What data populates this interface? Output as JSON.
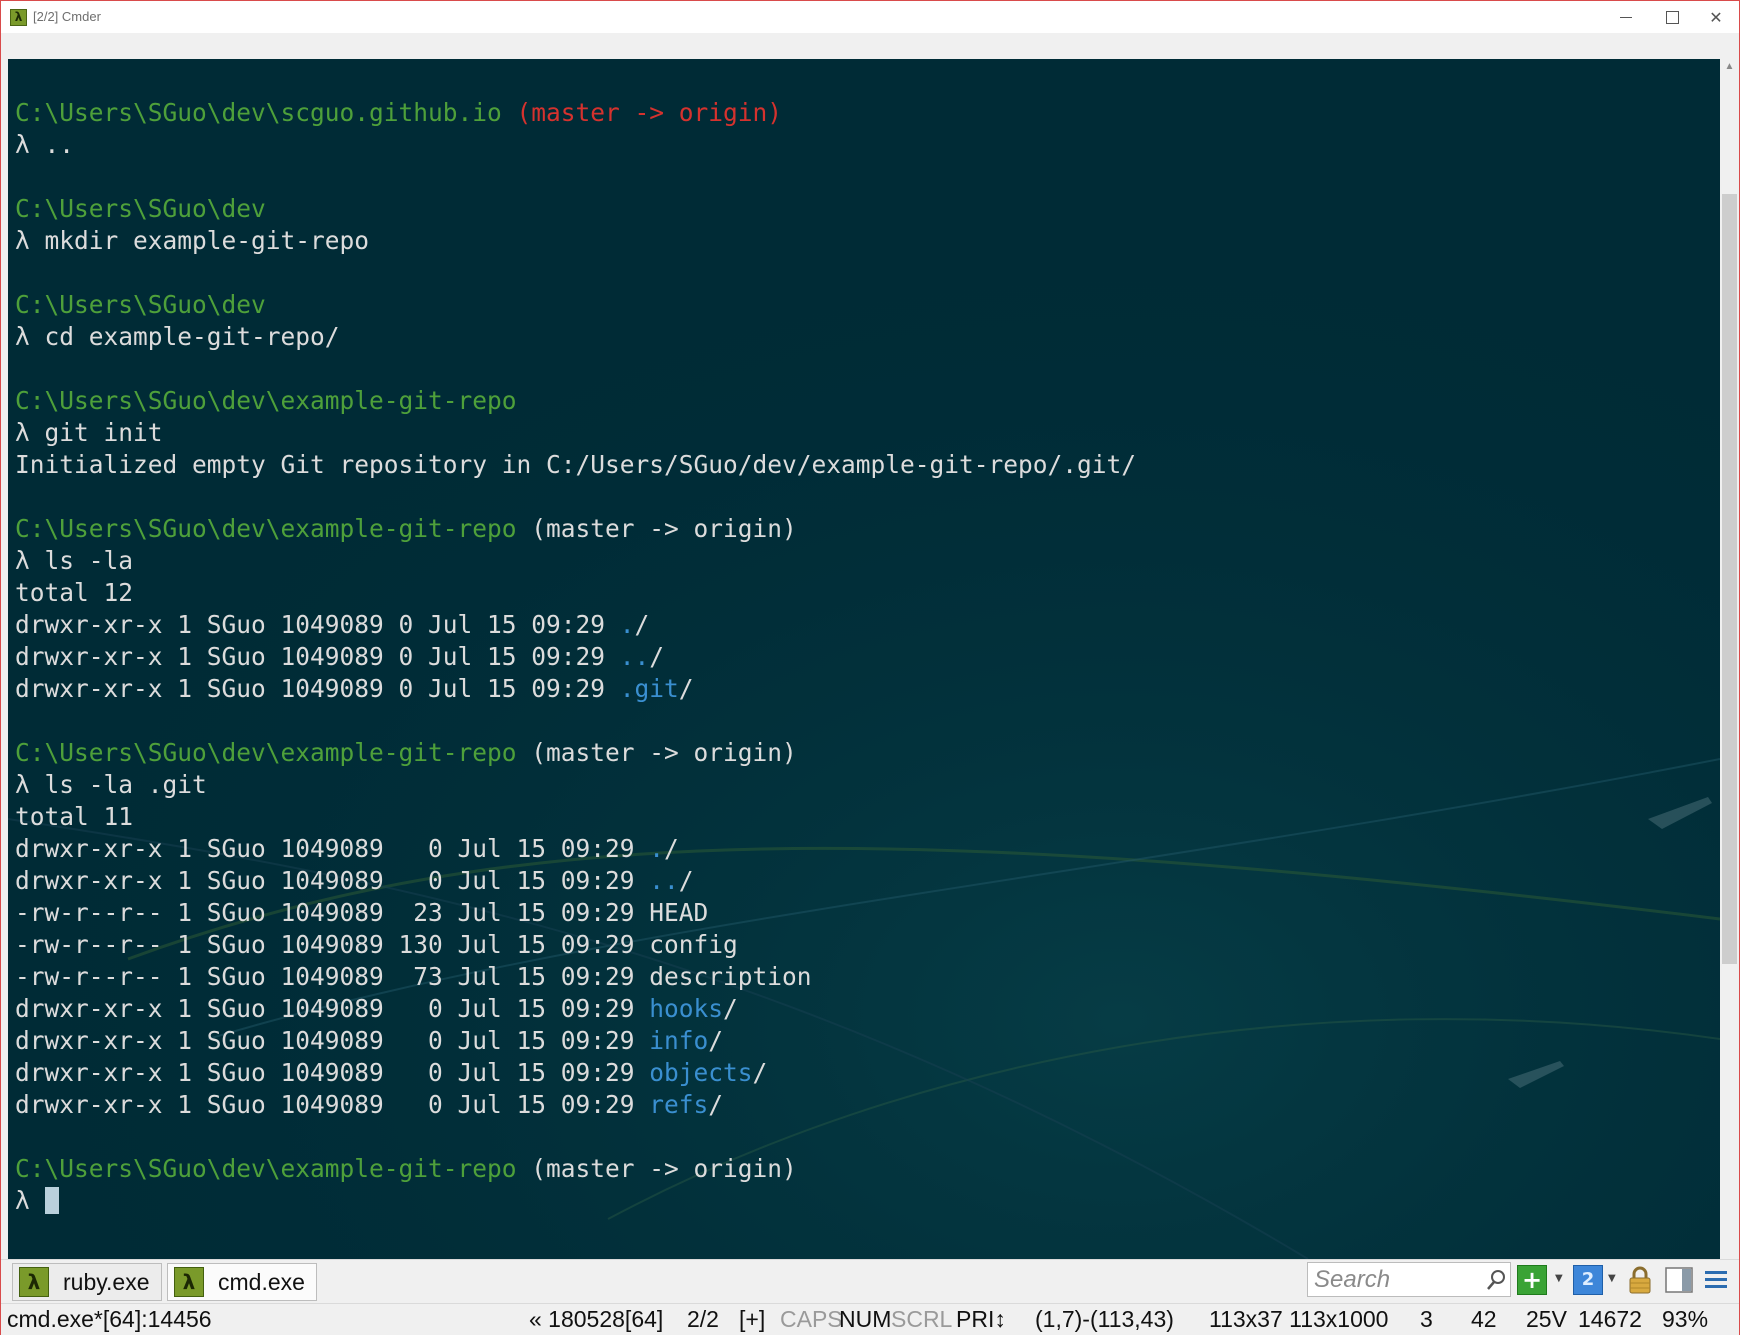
{
  "window": {
    "title": "[2/2] Cmder",
    "icon": "lambda-icon",
    "controls": [
      "minimize-icon",
      "maximize-icon",
      "close-icon"
    ]
  },
  "colors": {
    "console_bg": "#002b36",
    "path": "#4ea03a",
    "branch_red": "#d5322e",
    "directory": "#3a8fd0",
    "text": "#dcdcdc"
  },
  "console": {
    "lines": [
      [
        {
          "t": "C:\\Users\\SGuo\\dev\\scguo.github.io",
          "c": "path"
        },
        {
          "t": " (master -> origin)",
          "c": "red"
        }
      ],
      [
        {
          "t": "λ ..",
          "c": ""
        }
      ],
      [],
      [
        {
          "t": "C:\\Users\\SGuo\\dev",
          "c": "path"
        }
      ],
      [
        {
          "t": "λ mkdir example-git-repo",
          "c": ""
        }
      ],
      [],
      [
        {
          "t": "C:\\Users\\SGuo\\dev",
          "c": "path"
        }
      ],
      [
        {
          "t": "λ cd example-git-repo/",
          "c": ""
        }
      ],
      [],
      [
        {
          "t": "C:\\Users\\SGuo\\dev\\example-git-repo",
          "c": "path"
        }
      ],
      [
        {
          "t": "λ git init",
          "c": ""
        }
      ],
      [
        {
          "t": "Initialized empty Git repository in C:/Users/SGuo/dev/example-git-repo/.git/",
          "c": ""
        }
      ],
      [],
      [
        {
          "t": "C:\\Users\\SGuo\\dev\\example-git-repo",
          "c": "path"
        },
        {
          "t": " (master -> origin)",
          "c": ""
        }
      ],
      [
        {
          "t": "λ ls -la",
          "c": ""
        }
      ],
      [
        {
          "t": "total 12",
          "c": ""
        }
      ],
      [
        {
          "t": "drwxr-xr-x 1 SGuo 1049089 0 Jul 15 09:29 ",
          "c": ""
        },
        {
          "t": ".",
          "c": "dir"
        },
        {
          "t": "/",
          "c": ""
        }
      ],
      [
        {
          "t": "drwxr-xr-x 1 SGuo 1049089 0 Jul 15 09:29 ",
          "c": ""
        },
        {
          "t": "..",
          "c": "dir"
        },
        {
          "t": "/",
          "c": ""
        }
      ],
      [
        {
          "t": "drwxr-xr-x 1 SGuo 1049089 0 Jul 15 09:29 ",
          "c": ""
        },
        {
          "t": ".git",
          "c": "dir"
        },
        {
          "t": "/",
          "c": ""
        }
      ],
      [],
      [
        {
          "t": "C:\\Users\\SGuo\\dev\\example-git-repo",
          "c": "path"
        },
        {
          "t": " (master -> origin)",
          "c": ""
        }
      ],
      [
        {
          "t": "λ ls -la .git",
          "c": ""
        }
      ],
      [
        {
          "t": "total 11",
          "c": ""
        }
      ],
      [
        {
          "t": "drwxr-xr-x 1 SGuo 1049089   0 Jul 15 09:29 ",
          "c": ""
        },
        {
          "t": ".",
          "c": "dir"
        },
        {
          "t": "/",
          "c": ""
        }
      ],
      [
        {
          "t": "drwxr-xr-x 1 SGuo 1049089   0 Jul 15 09:29 ",
          "c": ""
        },
        {
          "t": "..",
          "c": "dir"
        },
        {
          "t": "/",
          "c": ""
        }
      ],
      [
        {
          "t": "-rw-r--r-- 1 SGuo 1049089  23 Jul 15 09:29 HEAD",
          "c": ""
        }
      ],
      [
        {
          "t": "-rw-r--r-- 1 SGuo 1049089 130 Jul 15 09:29 config",
          "c": ""
        }
      ],
      [
        {
          "t": "-rw-r--r-- 1 SGuo 1049089  73 Jul 15 09:29 description",
          "c": ""
        }
      ],
      [
        {
          "t": "drwxr-xr-x 1 SGuo 1049089   0 Jul 15 09:29 ",
          "c": ""
        },
        {
          "t": "hooks",
          "c": "dir"
        },
        {
          "t": "/",
          "c": ""
        }
      ],
      [
        {
          "t": "drwxr-xr-x 1 SGuo 1049089   0 Jul 15 09:29 ",
          "c": ""
        },
        {
          "t": "info",
          "c": "dir"
        },
        {
          "t": "/",
          "c": ""
        }
      ],
      [
        {
          "t": "drwxr-xr-x 1 SGuo 1049089   0 Jul 15 09:29 ",
          "c": ""
        },
        {
          "t": "objects",
          "c": "dir"
        },
        {
          "t": "/",
          "c": ""
        }
      ],
      [
        {
          "t": "drwxr-xr-x 1 SGuo 1049089   0 Jul 15 09:29 ",
          "c": ""
        },
        {
          "t": "refs",
          "c": "dir"
        },
        {
          "t": "/",
          "c": ""
        }
      ],
      [],
      [
        {
          "t": "C:\\Users\\SGuo\\dev\\example-git-repo",
          "c": "path"
        },
        {
          "t": " (master -> origin)",
          "c": ""
        }
      ],
      [
        {
          "t": "λ ",
          "c": ""
        },
        {
          "t": "",
          "c": "cursor"
        }
      ]
    ]
  },
  "tabs": [
    {
      "label": "ruby.exe",
      "icon": "lambda-icon",
      "active": false
    },
    {
      "label": "cmd.exe",
      "icon": "lambda-icon",
      "active": true
    }
  ],
  "toolbar": {
    "search_placeholder": "Search",
    "search_icon": "search-icon",
    "new_console_icon": "plus-icon",
    "console_number": "2",
    "lock_icon": "lock-icon",
    "panel_icon": "split-panel-icon",
    "menu_icon": "hamburger-menu-icon"
  },
  "statusbar": {
    "process": "cmd.exe*[64]:14456",
    "buffer": "« 180528[64]",
    "console_index": "2/2",
    "plus": "[+]",
    "caps": "CAPS",
    "num": "NUM",
    "scrl": "SCRL",
    "pri": "PRI↕",
    "selection": "(1,7)-(113,43)",
    "size": "113x37 113x1000",
    "val1": "3",
    "val2": "42",
    "voltage": "25V",
    "val3": "14672",
    "percent": "93%"
  }
}
